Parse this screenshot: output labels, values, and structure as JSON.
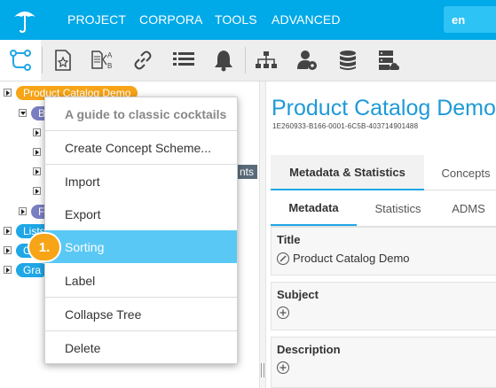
{
  "nav": {
    "items": [
      "PROJECT",
      "CORPORA",
      "TOOLS",
      "ADVANCED"
    ],
    "lang": "en"
  },
  "toolbar": {
    "icons": [
      "hierarchy-icon",
      "concept-document-icon",
      "mapping-icon",
      "link-icon",
      "list-icon",
      "notification-bell-icon",
      "org-chart-icon",
      "user-settings-icon",
      "database-icon",
      "server-icon"
    ]
  },
  "tree": {
    "root": "Product Catalog Demo",
    "child_initial": "B",
    "child2_initial": "F",
    "lists_label": "Lists",
    "c_label": "C",
    "graph_label": "Gra",
    "dark_label": "nts"
  },
  "context_menu": {
    "header": "A guide to classic cocktails",
    "items": [
      "Create Concept Scheme...",
      "Import",
      "Export",
      "Sorting",
      "Label",
      "Collapse Tree",
      "Delete"
    ],
    "selected": "Sorting",
    "step_badge": "1."
  },
  "detail": {
    "title": "Product Catalog Demo",
    "uuid": "1E260933-B166-0001-6C5B-403714901488",
    "tabs": [
      "Metadata & Statistics",
      "Concepts"
    ],
    "subtabs": [
      "Metadata",
      "Statistics",
      "ADMS"
    ],
    "fields": {
      "title_label": "Title",
      "title_value": "Product Catalog Demo",
      "subject_label": "Subject",
      "description_label": "Description"
    }
  },
  "colors": {
    "accent": "#00a9e8",
    "selected": "#5ac8f5",
    "orange": "#f7a416",
    "title_blue": "#1e9ad6"
  }
}
